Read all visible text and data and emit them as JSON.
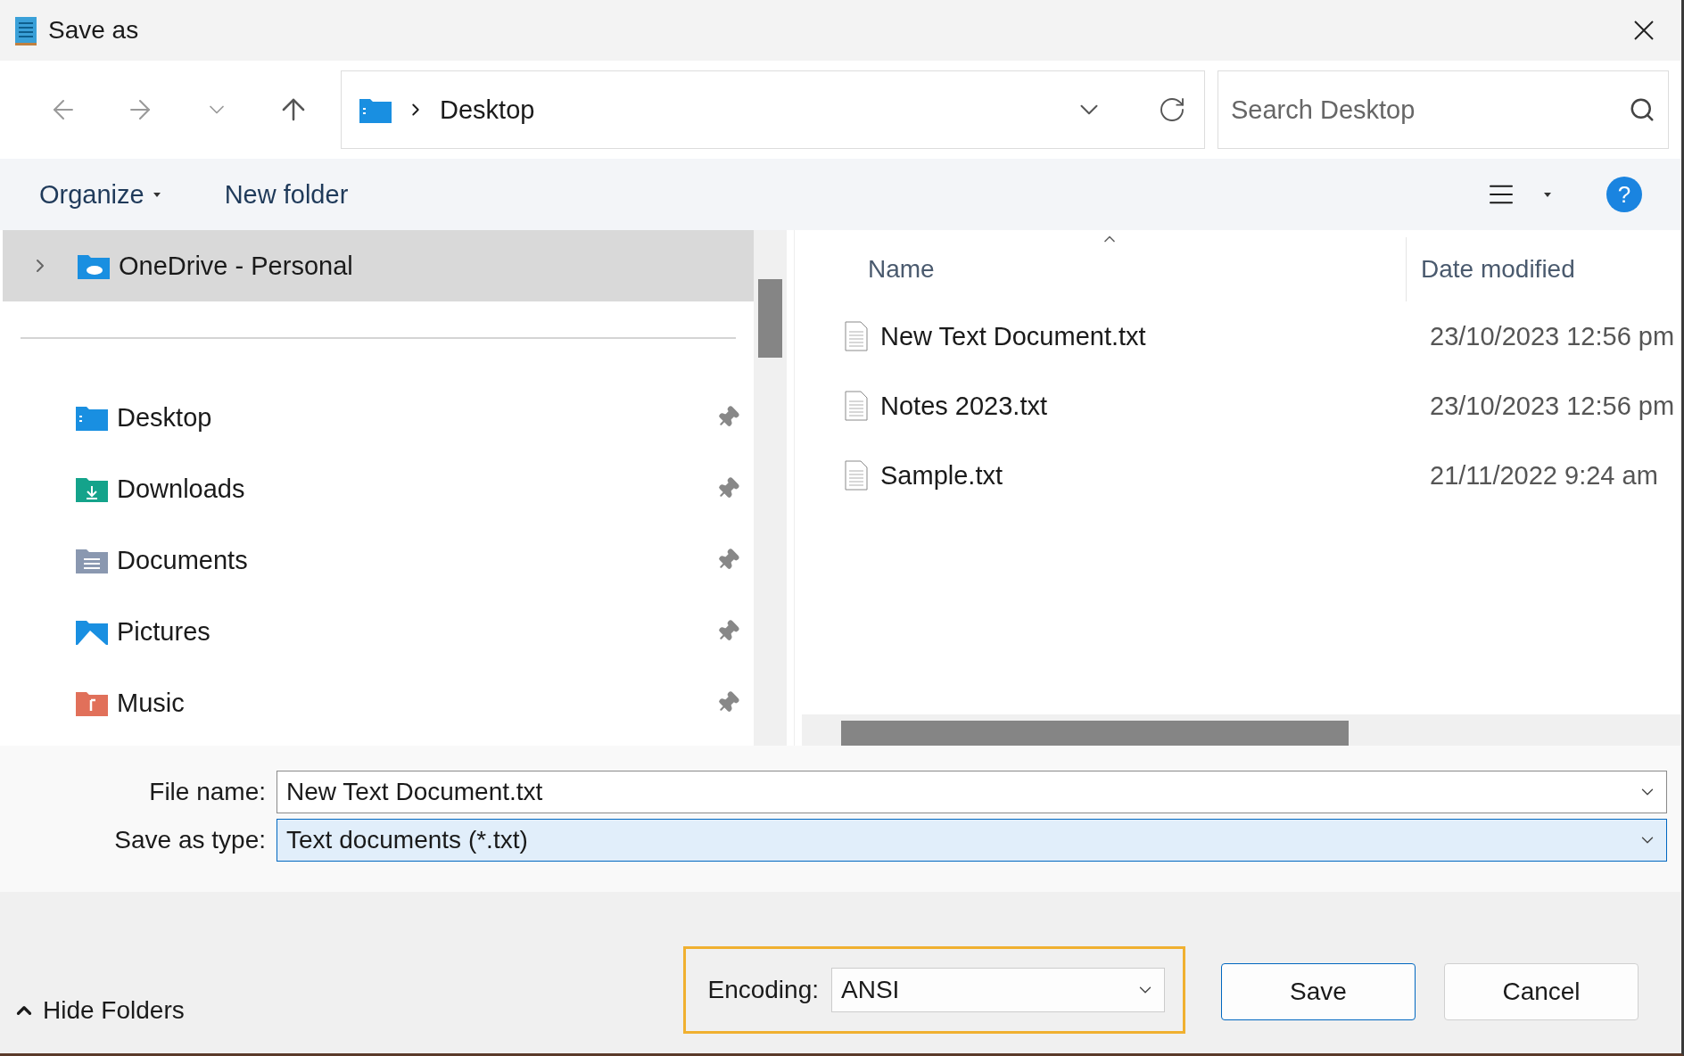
{
  "window": {
    "title": "Save as"
  },
  "address": {
    "location": "Desktop"
  },
  "search": {
    "placeholder": "Search Desktop"
  },
  "toolbar": {
    "organize": "Organize",
    "new_folder": "New folder"
  },
  "sidebar": {
    "items": [
      {
        "label": "OneDrive - Personal",
        "kind": "cloud",
        "selected": true,
        "pinned": false
      },
      {
        "label": "Desktop",
        "kind": "desktop",
        "selected": false,
        "pinned": true
      },
      {
        "label": "Downloads",
        "kind": "downloads",
        "selected": false,
        "pinned": true
      },
      {
        "label": "Documents",
        "kind": "documents",
        "selected": false,
        "pinned": true
      },
      {
        "label": "Pictures",
        "kind": "pictures",
        "selected": false,
        "pinned": true
      },
      {
        "label": "Music",
        "kind": "music",
        "selected": false,
        "pinned": true
      }
    ]
  },
  "file_list": {
    "columns": [
      {
        "label": "Name",
        "sorted": true
      },
      {
        "label": "Date modified",
        "sorted": false
      }
    ],
    "rows": [
      {
        "name": "New Text Document.txt",
        "date": "23/10/2023 12:56 pm"
      },
      {
        "name": "Notes 2023.txt",
        "date": "23/10/2023 12:56 pm"
      },
      {
        "name": "Sample.txt",
        "date": "21/11/2022 9:24 am"
      }
    ]
  },
  "form": {
    "fields": [
      {
        "label": "File name:",
        "value": "New Text Document.txt",
        "selected": false
      },
      {
        "label": "Save as type:",
        "value": "Text documents (*.txt)",
        "selected": true
      }
    ]
  },
  "encoding": {
    "label": "Encoding:",
    "value": "ANSI",
    "highlighted": true
  },
  "buttons": [
    {
      "label": "Save",
      "default": true
    },
    {
      "label": "Cancel",
      "default": false
    }
  ],
  "hide_folders": "Hide Folders",
  "help": "?"
}
